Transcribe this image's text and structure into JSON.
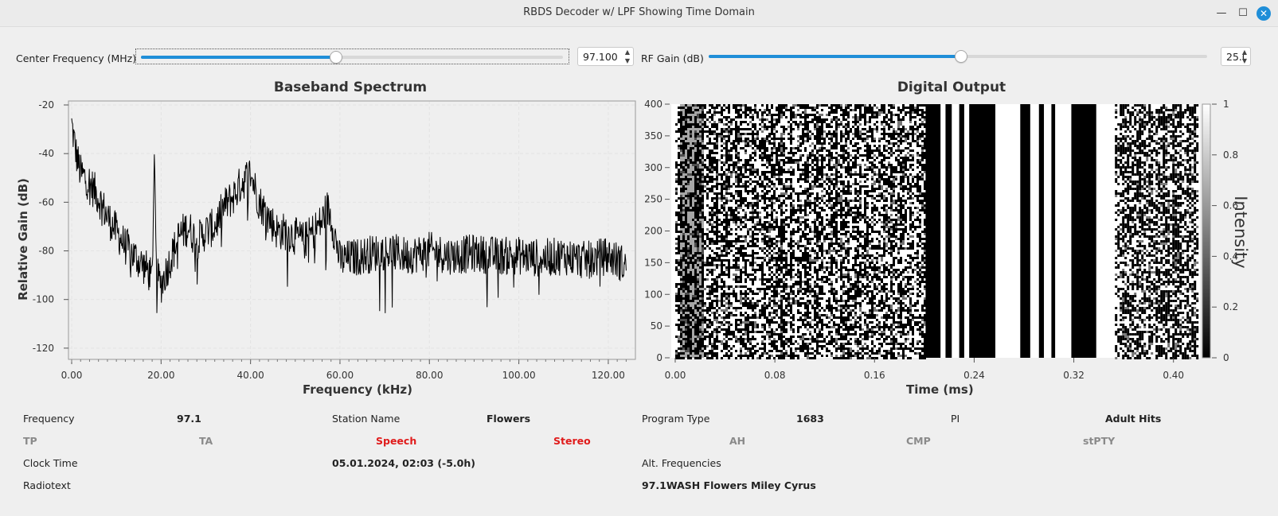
{
  "window": {
    "title": "RBDS Decoder w/ LPF Showing Time Domain",
    "minimize_glyph": "—",
    "maximize_glyph": "☐",
    "close_glyph": "✕"
  },
  "controls": {
    "center_freq": {
      "label": "Center Frequency (MHz)",
      "value": "97.100",
      "slider_fraction": 0.46
    },
    "rf_gain": {
      "label": "RF Gain (dB)",
      "value": "25.0",
      "slider_fraction": 0.504
    },
    "spin_up": "▲",
    "spin_down": "▼"
  },
  "spectrum": {
    "title": "Baseband Spectrum",
    "xlabel": "Frequency (kHz)",
    "ylabel": "Relative Gain (dB)",
    "xticks": [
      "0.00",
      "20.00",
      "40.00",
      "60.00",
      "80.00",
      "100.00",
      "120.00"
    ],
    "yticks": [
      "-20",
      "-40",
      "-60",
      "-80",
      "-100",
      "-120"
    ]
  },
  "digital": {
    "title": "Digital Output",
    "xlabel": "Time (ms)",
    "colorbar_label": "Intensity",
    "xticks": [
      "0.00",
      "0.08",
      "0.16",
      "0.24",
      "0.32",
      "0.40"
    ],
    "yticks": [
      "400",
      "350",
      "300",
      "250",
      "200",
      "150",
      "100",
      "50",
      "0"
    ],
    "cticks": [
      "1",
      "0.8",
      "0.6",
      "0.4",
      "0.2",
      "0"
    ]
  },
  "rds": {
    "frequency_label": "Frequency",
    "frequency_value": "97.1",
    "station_label": "Station Name",
    "station_value": "Flowers",
    "program_type_label": "Program Type",
    "program_type_value": "1683",
    "pi_label": "PI",
    "pi_value": "Adult Hits",
    "tp": "TP",
    "ta": "TA",
    "speech": "Speech",
    "stereo": "Stereo",
    "ah": "AH",
    "cmp": "CMP",
    "stpty": "stPTY",
    "clock_label": "Clock Time",
    "clock_value": "05.01.2024, 02:03 (-5.0h)",
    "alt_label": "Alt. Frequencies",
    "radiotext_label": "Radiotext",
    "radiotext_value": "97.1WASH Flowers Miley Cyrus"
  },
  "colors": {
    "accent": "#1f8ed8",
    "flag_on": "#e01b1b",
    "flag_off": "#8a8a8a"
  },
  "chart_data": [
    {
      "type": "line",
      "title": "Baseband Spectrum",
      "xlabel": "Frequency (kHz)",
      "ylabel": "Relative Gain (dB)",
      "xlim": [
        0,
        125
      ],
      "ylim": [
        -122,
        -20
      ],
      "grid": true,
      "x": [
        0,
        1,
        2,
        4,
        6,
        8,
        10,
        12,
        14,
        16,
        17,
        18,
        18.5,
        19,
        20,
        22,
        24,
        26,
        28,
        30,
        32,
        34,
        36,
        38,
        40,
        42,
        44,
        46,
        48,
        50,
        52,
        54,
        56,
        57,
        58,
        60,
        65,
        70,
        75,
        80,
        85,
        90,
        95,
        100,
        105,
        110,
        115,
        120,
        124
      ],
      "series": [
        {
          "values": [
            -28,
            -40,
            -48,
            -52,
            -58,
            -66,
            -72,
            -78,
            -82,
            -86,
            -88,
            -92,
            -39,
            -90,
            -94,
            -84,
            -74,
            -70,
            -76,
            -72,
            -70,
            -62,
            -58,
            -52,
            -48,
            -60,
            -66,
            -72,
            -72,
            -74,
            -76,
            -72,
            -68,
            -62,
            -66,
            -84,
            -82,
            -80,
            -82,
            -80,
            -82,
            -81,
            -82,
            -82,
            -83,
            -82,
            -84,
            -82,
            -86
          ]
        }
      ]
    },
    {
      "type": "heatmap",
      "title": "Digital Output",
      "xlabel": "Time (ms)",
      "ylabel": "",
      "xlim": [
        0,
        0.42
      ],
      "ylim": [
        0,
        400
      ],
      "colorbar": {
        "label": "Intensity",
        "range": [
          0,
          1
        ]
      },
      "solid_bands": [
        {
          "x0": 0.201,
          "x1": 0.213,
          "level": 1
        },
        {
          "x0": 0.217,
          "x1": 0.222,
          "level": 1
        },
        {
          "x0": 0.228,
          "x1": 0.232,
          "level": 1
        },
        {
          "x0": 0.236,
          "x1": 0.257,
          "level": 1
        },
        {
          "x0": 0.277,
          "x1": 0.285,
          "level": 1
        },
        {
          "x0": 0.292,
          "x1": 0.296,
          "level": 1
        },
        {
          "x0": 0.302,
          "x1": 0.305,
          "level": 1
        },
        {
          "x0": 0.318,
          "x1": 0.338,
          "level": 1
        }
      ]
    }
  ]
}
